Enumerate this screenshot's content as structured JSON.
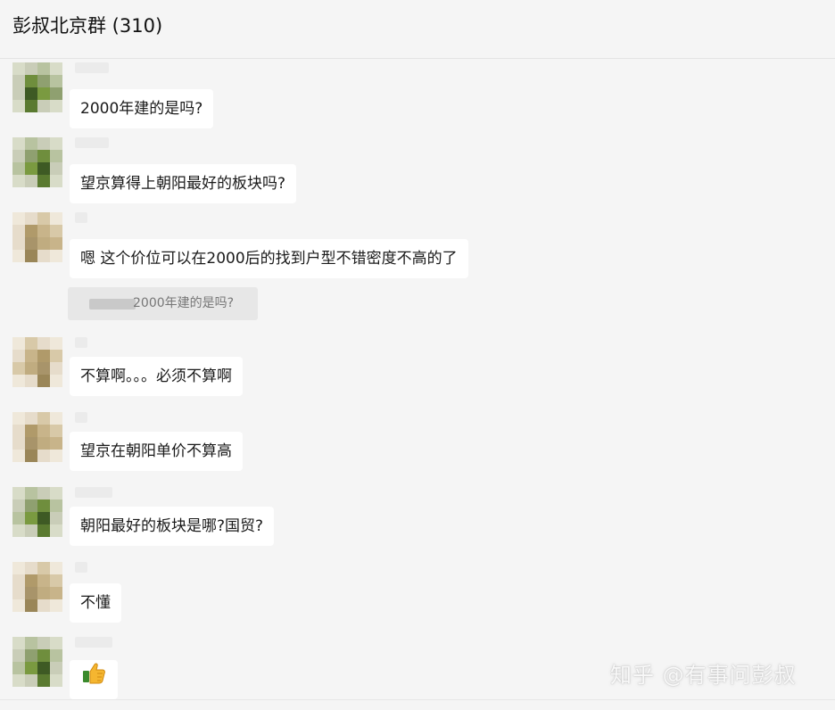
{
  "header": {
    "title": "彭叔北京群 (310)"
  },
  "messages": [
    {
      "text": "2000年建的是吗?",
      "avatar_palette": "green"
    },
    {
      "text": "望京算得上朝阳最好的板块吗?",
      "avatar_palette": "green"
    },
    {
      "text": "嗯 这个价位可以在2000后的找到户型不错密度不高的了",
      "avatar_palette": "tan",
      "quote": {
        "text": "2000年建的是吗?"
      }
    },
    {
      "text": "不算啊。。。必须不算啊",
      "avatar_palette": "tan"
    },
    {
      "text": "望京在朝阳单价不算高",
      "avatar_palette": "tan"
    },
    {
      "text": "朝阳最好的板块是哪?国贸?",
      "avatar_palette": "green"
    },
    {
      "text": "不懂",
      "avatar_palette": "tan"
    },
    {
      "emoji": "thumbs-up",
      "avatar_palette": "green"
    }
  ],
  "watermark": "知乎 @有事问彭叔",
  "colors": {
    "background": "#f5f5f5",
    "bubble": "#ffffff",
    "quote_background": "#e7e7e7",
    "avatar_green": [
      "#c9cdb8",
      "#8fa070",
      "#6f8e3d",
      "#5a7a30",
      "#b8c3a0",
      "#3e5a24",
      "#7a9a40",
      "#d8dcc8"
    ],
    "avatar_tan": [
      "#e6dccb",
      "#c8b48a",
      "#b09a6a",
      "#9a8658",
      "#d8c9a8",
      "#a8946a",
      "#c0ac80",
      "#efe8da"
    ]
  }
}
